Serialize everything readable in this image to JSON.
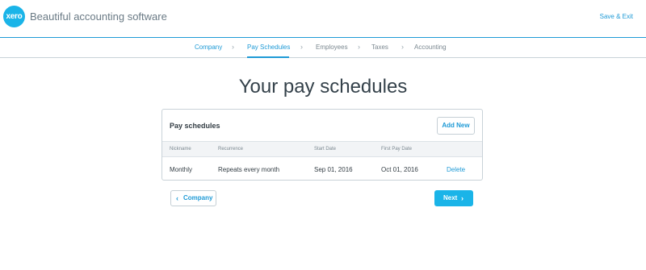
{
  "header": {
    "logo_text": "xero",
    "app_title": "Beautiful accounting software",
    "save_exit": "Save & Exit"
  },
  "steps": [
    {
      "label": "Company",
      "state": "done"
    },
    {
      "label": "Pay Schedules",
      "state": "active"
    },
    {
      "label": "Employees",
      "state": "upcoming"
    },
    {
      "label": "Taxes",
      "state": "upcoming"
    },
    {
      "label": "Accounting",
      "state": "upcoming"
    }
  ],
  "page_title": "Your pay schedules",
  "pay_schedules": {
    "title": "Pay schedules",
    "add_new": "Add New",
    "columns": [
      "Nickname",
      "Recurrence",
      "Start Date",
      "First Pay Date"
    ],
    "rows": [
      {
        "nickname": "Monthly",
        "recurrence": "Repeats every month",
        "start_date": "Sep 01, 2016",
        "first_pay_date": "Oct 01, 2016",
        "action": "Delete"
      }
    ]
  },
  "footer": {
    "back_label": "Company",
    "next_label": "Next"
  },
  "colors": {
    "accent": "#1e9ad6",
    "brand": "#1ab4e8"
  },
  "icons": {
    "step_separator": "chevron-right-icon",
    "back": "chevron-left-icon",
    "next": "chevron-right-icon"
  }
}
